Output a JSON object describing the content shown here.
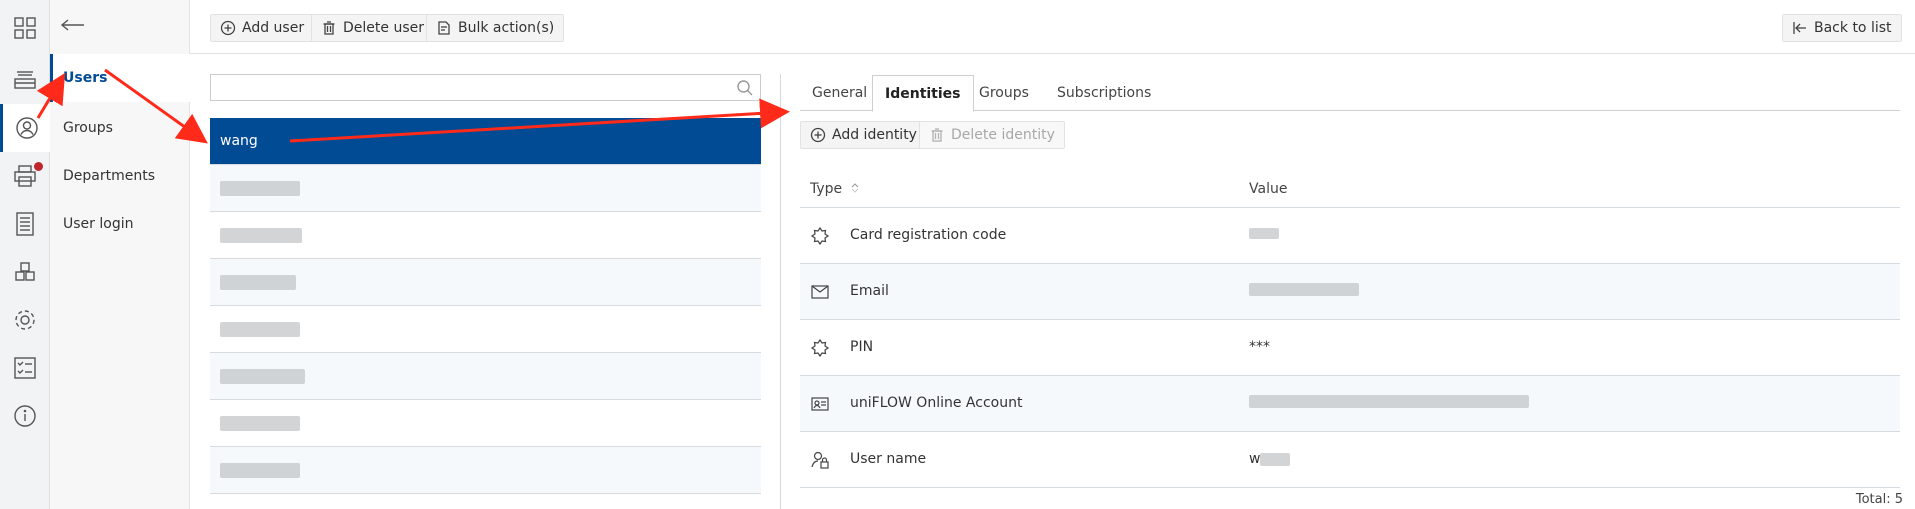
{
  "submenu": {
    "items": [
      {
        "label": "Users",
        "active": true
      },
      {
        "label": "Groups"
      },
      {
        "label": "Departments"
      },
      {
        "label": "User login"
      }
    ]
  },
  "toolbar": {
    "add_user": "Add user",
    "delete_user": "Delete user",
    "bulk_actions": "Bulk action(s)",
    "back_to_list": "Back to list"
  },
  "search": {
    "placeholder": ""
  },
  "users": {
    "selected": "wang",
    "rows": [
      "wang",
      "",
      "",
      "",
      "",
      "",
      "",
      ""
    ]
  },
  "tabs": [
    "General",
    "Identities",
    "Groups",
    "Subscriptions"
  ],
  "active_tab": "Identities",
  "identity_actions": {
    "add": "Add identity",
    "delete": "Delete identity"
  },
  "table": {
    "headers": {
      "type": "Type",
      "value": "Value"
    },
    "rows": [
      {
        "icon": "card-icon",
        "type": "Card registration code",
        "value": ""
      },
      {
        "icon": "email-icon",
        "type": "Email",
        "value": ""
      },
      {
        "icon": "pin-icon",
        "type": "PIN",
        "value": "***"
      },
      {
        "icon": "account-card-icon",
        "type": "uniFLOW Online Account",
        "value": ""
      },
      {
        "icon": "user-lock-icon",
        "type": "User name",
        "value": "w"
      }
    ]
  },
  "total": "Total: 5",
  "colors": {
    "accent": "#004b93",
    "annotation_arrow": "#ff2a1a",
    "notification": "#c0272d"
  }
}
